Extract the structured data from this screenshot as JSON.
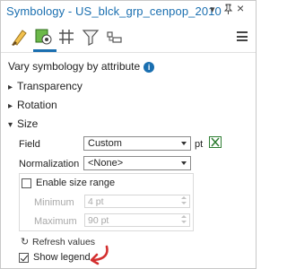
{
  "pane": {
    "title": "Symbology - US_blck_grp_cenpop_2010",
    "controls": {
      "menu": "▾",
      "pin": "⊐",
      "close": "×"
    }
  },
  "toolbar": {
    "tabs": [
      {
        "icon": "primary-symbology-icon",
        "active": true
      },
      {
        "icon": "vary-by-attribute-icon",
        "active": false
      },
      {
        "icon": "grid-icon",
        "active": false
      },
      {
        "icon": "filter-icon",
        "active": false
      },
      {
        "icon": "symbol-layers-icon",
        "active": false
      }
    ],
    "menu_icon": "hamburger-menu-icon"
  },
  "heading": {
    "label": "Vary symbology by attribute",
    "info_icon": "i"
  },
  "sections": {
    "transparency": "Transparency",
    "rotation": "Rotation",
    "size": "Size"
  },
  "size": {
    "field_label": "Field",
    "field_value": "Custom",
    "unit": "pt",
    "normalization_label": "Normalization",
    "normalization_value": "<None>",
    "enable_range_label": "Enable size range",
    "enable_range_checked": false,
    "minimum_label": "Minimum",
    "minimum_value": "4 pt",
    "maximum_label": "Maximum",
    "maximum_value": "90 pt",
    "refresh_label": "Refresh values",
    "show_legend_label": "Show legend",
    "show_legend_checked": true
  },
  "colors": {
    "accent": "#1a6fb0",
    "annotation_arrow": "#d32f2f",
    "expression_icon": "#2e7d32"
  }
}
